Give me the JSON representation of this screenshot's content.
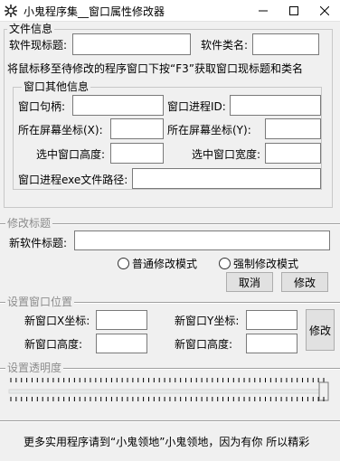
{
  "window": {
    "title": "小鬼程序集__窗口属性修改器",
    "minimize_icon": "minimize-icon",
    "maximize_icon": "maximize-icon",
    "close_icon": "close-icon"
  },
  "file_info": {
    "legend": "文件信息",
    "software_title_label": "软件现标题:",
    "software_title_value": "",
    "class_name_label": "软件类名:",
    "class_name_value": "",
    "hint": "将鼠标移至待修改的程序窗口下按“F3”获取窗口现标题和类名",
    "other_info": {
      "legend": "窗口其他信息",
      "handle_label": "窗口句柄:",
      "handle_value": "",
      "process_id_label": "窗口进程ID:",
      "process_id_value": "",
      "screen_x_label": "所在屏幕坐标(X):",
      "screen_x_value": "",
      "screen_y_label": "所在屏幕坐标(Y):",
      "screen_y_value": "",
      "height_label": "选中窗口高度:",
      "height_value": "",
      "width_label": "选中窗口宽度:",
      "width_value": "",
      "exe_path_label": "窗口进程exe文件路径:",
      "exe_path_value": ""
    }
  },
  "modify_title": {
    "legend": "修改标题",
    "new_title_label": "新软件标题:",
    "new_title_value": "",
    "mode_normal": "普通修改模式",
    "mode_force": "强制修改模式",
    "cancel_button": "取消",
    "modify_button": "修改"
  },
  "position": {
    "legend": "设置窗口位置",
    "new_x_label": "新窗口X坐标:",
    "new_x_value": "",
    "new_y_label": "新窗口Y坐标:",
    "new_y_value": "",
    "new_height_label": "新窗口高度:",
    "new_height_value": "",
    "new_height2_label": "新窗口高度:",
    "new_height2_value": "",
    "modify_button": "修改"
  },
  "transparency": {
    "legend": "设置透明度",
    "tick_count": 60,
    "slider_level": 1.0
  },
  "footer": {
    "text": "更多实用程序请到“小鬼领地”小鬼领地，因为有你 所以精彩"
  },
  "colors": {
    "disabled_text": "#8c8c8c",
    "button_face": "#e1e1e1",
    "window_bg": "#f0f0f0"
  }
}
